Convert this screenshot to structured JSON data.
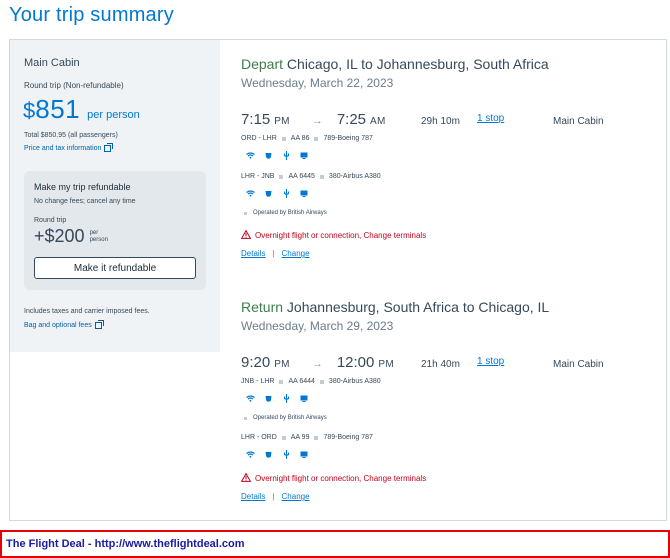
{
  "page": {
    "title": "Your trip summary"
  },
  "sidebar": {
    "cabin": "Main Cabin",
    "trip_type": "Round trip (Non-refundable)",
    "currency_symbol": "$",
    "price": "851",
    "per_person": "per person",
    "total": "Total $850.95 (all passengers)",
    "price_tax_link": "Price and tax information",
    "refund": {
      "title": "Make my trip refundable",
      "note": "No change fees; cancel any time",
      "round_trip": "Round trip",
      "price": "+$200",
      "per_person": "per person",
      "button": "Make it refundable"
    },
    "taxes_note": "Includes taxes and carrier imposed fees.",
    "bag_link": "Bag and optional fees"
  },
  "depart": {
    "direction": "Depart",
    "route": "Chicago, IL to Johannesburg, South Africa",
    "date": "Wednesday, March 22, 2023",
    "dep_time": "7:15",
    "dep_ampm": "PM",
    "arrow": "→",
    "arr_time": "7:25",
    "arr_ampm": "AM",
    "duration": "29h 10m",
    "stops": "1 stop",
    "cabin": "Main Cabin",
    "leg1": {
      "route": "ORD - LHR",
      "flight": "AA 86",
      "aircraft": "789-Boeing 787"
    },
    "leg2": {
      "route": "LHR - JNB",
      "flight": "AA 6445",
      "aircraft": "380-Airbus A380"
    },
    "operated": "Operated by British Airways",
    "warning": "Overnight flight or connection, Change terminals",
    "details_link": "Details",
    "separator": "|",
    "change_link": "Change"
  },
  "return": {
    "direction": "Return",
    "route": "Johannesburg, South Africa to Chicago, IL",
    "date": "Wednesday, March 29, 2023",
    "dep_time": "9:20",
    "dep_ampm": "PM",
    "arrow": "→",
    "arr_time": "12:00",
    "arr_ampm": "PM",
    "duration": "21h 40m",
    "stops": "1 stop",
    "cabin": "Main Cabin",
    "leg1": {
      "route": "JNB - LHR",
      "flight": "AA 6444",
      "aircraft": "380-Airbus A380"
    },
    "leg2": {
      "route": "LHR - ORD",
      "flight": "AA 99",
      "aircraft": "789-Boeing 787"
    },
    "operated": "Operated by British Airways",
    "warning": "Overnight flight or connection, Change terminals",
    "details_link": "Details",
    "separator": "|",
    "change_link": "Change"
  },
  "footer": {
    "text": "The Flight Deal - http://www.theflightdeal.com"
  },
  "colors": {
    "accent": "#0078d2",
    "direction": "#3d7e4b",
    "warning": "#c30019",
    "footer_border": "#e60000"
  }
}
